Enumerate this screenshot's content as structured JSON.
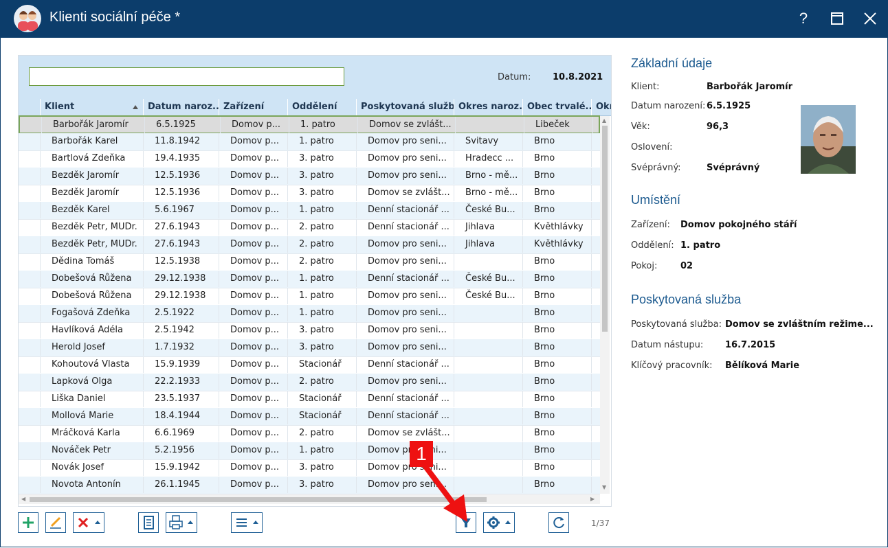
{
  "window": {
    "title": "Klienti sociální péče *",
    "help": "?",
    "maximize": "☐",
    "close": "✕"
  },
  "filter": {
    "search_value": "",
    "date_label": "Datum:",
    "date_value": "10.8.2021"
  },
  "columns": [
    "Klient",
    "Datum naroz...",
    "Zařízení",
    "Oddělení",
    "Poskytovaná služba",
    "Okres naroz...",
    "Obec trvalé...",
    "Okr"
  ],
  "rows": [
    [
      "Barbořák Jaromír",
      "6.5.1925",
      "Domov p...",
      "1. patro",
      "Domov se zvlášt...",
      "",
      "Libeček"
    ],
    [
      "Barbořák Karel",
      "11.8.1942",
      "Domov p...",
      "1. patro",
      "Domov pro seni...",
      "Svitavy",
      "Brno"
    ],
    [
      "Bartlová Zdeňka",
      "19.4.1935",
      "Domov p...",
      "3. patro",
      "Domov pro seni...",
      "Hradecc ...",
      "Brno"
    ],
    [
      "Bezděk Jaromír",
      "12.5.1936",
      "Domov p...",
      "3. patro",
      "Domov pro seni...",
      "Brno - mě...",
      "Brno"
    ],
    [
      "Bezděk Jaromír",
      "12.5.1936",
      "Domov p...",
      "3. patro",
      "Domov se zvlášt...",
      "Brno - mě...",
      "Brno"
    ],
    [
      "Bezděk Karel",
      "5.6.1967",
      "Domov p...",
      "1. patro",
      "Denní stacionář ...",
      "České Bu...",
      "Brno"
    ],
    [
      "Bezděk Petr, MUDr.",
      "27.6.1943",
      "Domov p...",
      "2. patro",
      "Denní stacionář ...",
      "Jihlava",
      "Květhlávky"
    ],
    [
      "Bezděk Petr, MUDr.",
      "27.6.1943",
      "Domov p...",
      "2. patro",
      "Domov pro seni...",
      "Jihlava",
      "Květhlávky"
    ],
    [
      "Dědina Tomáš",
      "12.5.1938",
      "Domov p...",
      "2. patro",
      "Domov pro seni...",
      "",
      "Brno"
    ],
    [
      "Dobešová Růžena",
      "29.12.1938",
      "Domov p...",
      "1. patro",
      "Denní stacionář ...",
      "České Bu...",
      "Brno"
    ],
    [
      "Dobešová Růžena",
      "29.12.1938",
      "Domov p...",
      "1. patro",
      "Domov pro seni...",
      "České Bu...",
      "Brno"
    ],
    [
      "Fogašová Zdeňka",
      "2.5.1922",
      "Domov p...",
      "1. patro",
      "Domov pro seni...",
      "",
      "Brno"
    ],
    [
      "Havlíková Adéla",
      "2.5.1942",
      "Domov p...",
      "3. patro",
      "Domov pro seni...",
      "",
      "Brno"
    ],
    [
      "Herold Josef",
      "1.7.1932",
      "Domov p...",
      "3. patro",
      "Domov pro seni...",
      "",
      "Brno"
    ],
    [
      "Kohoutová Vlasta",
      "15.9.1939",
      "Domov p...",
      "Stacionář",
      "Denní stacionář ...",
      "",
      "Brno"
    ],
    [
      "Lapková Olga",
      "22.2.1933",
      "Domov p...",
      "2. patro",
      "Domov pro seni...",
      "",
      "Brno"
    ],
    [
      "Liška Daniel",
      "23.5.1937",
      "Domov p...",
      "Stacionář",
      "Denní stacionář ...",
      "",
      "Brno"
    ],
    [
      "Mollová Marie",
      "18.4.1944",
      "Domov p...",
      "Stacionář",
      "Denní stacionář ...",
      "",
      "Brno"
    ],
    [
      "Mráčková Karla",
      "6.6.1969",
      "Domov p...",
      "2. patro",
      "Domov se zvlášt...",
      "",
      "Brno"
    ],
    [
      "Nováček Petr",
      "5.2.1956",
      "Domov p...",
      "1. patro",
      "Domov pro seni...",
      "",
      "Brno"
    ],
    [
      "Novák Josef",
      "15.9.1942",
      "Domov p...",
      "3. patro",
      "Domov pro seni...",
      "",
      "Brno"
    ],
    [
      "Novota Antonín",
      "26.1.1945",
      "Domov p...",
      "3. patro",
      "Domov pro seni...",
      "",
      "Brno"
    ]
  ],
  "pager": {
    "count": "1/37"
  },
  "annotation": {
    "number": "1"
  },
  "toolbar_icons": [
    "add-icon",
    "edit-icon",
    "delete-icon",
    "document-icon",
    "print-icon",
    "menu-icon",
    "filter-icon",
    "settings-icon",
    "refresh-icon"
  ],
  "detail": {
    "basic": {
      "title": "Základní údaje",
      "client_label": "Klient:",
      "client_value": "Barbořák Jaromír",
      "dob_label": "Datum narození:",
      "dob_value": "6.5.1925",
      "age_label": "Věk:",
      "age_value": "96,3",
      "salutation_label": "Oslovení:",
      "salutation_value": "",
      "competent_label": "Svéprávný:",
      "competent_value": "Svéprávný"
    },
    "placement": {
      "title": "Umístění",
      "facility_label": "Zařízení:",
      "facility_value": "Domov pokojného stáří",
      "department_label": "Oddělení:",
      "department_value": "1. patro",
      "room_label": "Pokoj:",
      "room_value": "02"
    },
    "service": {
      "title": "Poskytovaná služba",
      "service_label": "Poskytovaná služba:",
      "service_value": "Domov se zvláštním režime...",
      "start_label": "Datum nástupu:",
      "start_value": "16.7.2015",
      "worker_label": "Klíčový pracovník:",
      "worker_value": "Bělíková Marie"
    }
  },
  "colors": {
    "titlebar": "#0c3d6b",
    "header_bg": "#cfe4f5",
    "accent": "#1c5a8f",
    "selection_border": "#7aa55a",
    "annotation": "#ee1111"
  }
}
